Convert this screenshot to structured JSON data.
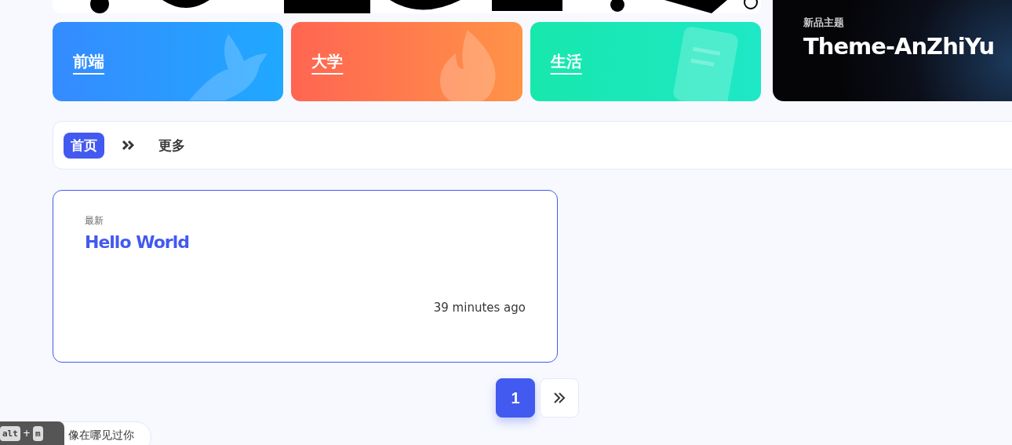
{
  "categories": [
    {
      "label": "前端",
      "kind": "bird"
    },
    {
      "label": "大学",
      "kind": "fire"
    },
    {
      "label": "生活",
      "kind": "note"
    }
  ],
  "feature": {
    "eyebrow": "新品主题",
    "title": "Theme-AnZhiYu"
  },
  "nav": {
    "items": [
      {
        "label": "首页",
        "selected": true
      },
      {
        "label": "更多",
        "selected": false
      }
    ]
  },
  "posts": [
    {
      "tag": "最新",
      "title": "Hello World",
      "time": "39 minutes ago"
    }
  ],
  "pagination": {
    "pages": [
      {
        "label": "1",
        "selected": true
      }
    ]
  },
  "shortcut": {
    "keys": [
      "alt",
      "m"
    ],
    "joiner": "+"
  },
  "bubble": {
    "text": "像在哪见过你"
  }
}
